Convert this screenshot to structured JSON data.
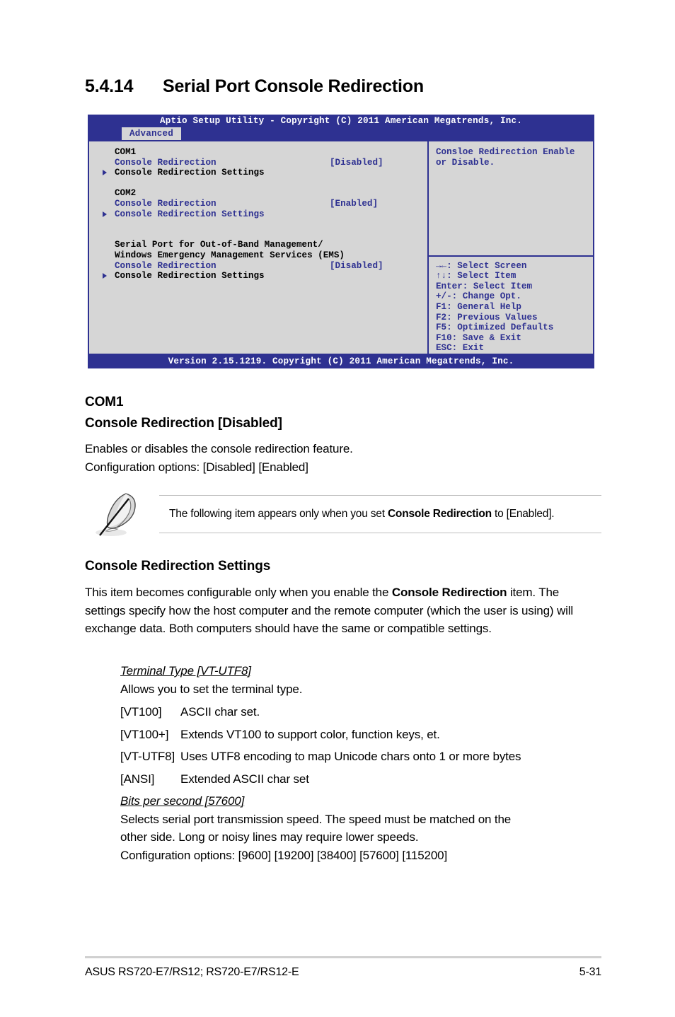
{
  "heading": {
    "number": "5.4.14",
    "title": "Serial Port Console Redirection"
  },
  "bios": {
    "titlebar": "Aptio Setup Utility - Copyright (C) 2011 American Megatrends, Inc.",
    "tab": "Advanced",
    "left_items": [
      {
        "label": "COM1",
        "value": "",
        "marker": false,
        "label_color": "black",
        "value_color": "black"
      },
      {
        "label": "Console Redirection",
        "value": "[Disabled]",
        "marker": false,
        "label_color": "blue",
        "value_color": "blue"
      },
      {
        "label": "Console Redirection Settings",
        "value": "",
        "marker": true,
        "label_color": "black",
        "value_color": "black"
      },
      {
        "label": "",
        "value": "",
        "marker": false,
        "label_color": "black",
        "value_color": "black"
      },
      {
        "label": "COM2",
        "value": "",
        "marker": false,
        "label_color": "black",
        "value_color": "black"
      },
      {
        "label": "Console Redirection",
        "value": "[Enabled]",
        "marker": false,
        "label_color": "blue",
        "value_color": "blue"
      },
      {
        "label": "Console Redirection Settings",
        "value": "",
        "marker": true,
        "label_color": "blue",
        "value_color": "blue"
      },
      {
        "label": "",
        "value": "",
        "marker": false,
        "label_color": "black",
        "value_color": "black"
      },
      {
        "label": "",
        "value": "",
        "marker": false,
        "label_color": "black",
        "value_color": "black"
      },
      {
        "label": "Serial Port for Out-of-Band Management/",
        "value": "",
        "marker": false,
        "label_color": "black",
        "value_color": "black"
      },
      {
        "label": "Windows Emergency Management Services (EMS)",
        "value": "",
        "marker": false,
        "label_color": "black",
        "value_color": "black"
      },
      {
        "label": "Console Redirection",
        "value": "[Disabled]",
        "marker": false,
        "label_color": "blue",
        "value_color": "blue"
      },
      {
        "label": "Console Redirection Settings",
        "value": "",
        "marker": true,
        "label_color": "black",
        "value_color": "black"
      }
    ],
    "help_lines": [
      "Consloe Redirection Enable",
      "or Disable."
    ],
    "key_legend": [
      "→←: Select Screen",
      "↑↓:  Select Item",
      "Enter: Select Item",
      "+/-: Change Opt.",
      "F1: General Help",
      "F2: Previous Values",
      "F5: Optimized Defaults",
      "F10: Save & Exit",
      "ESC: Exit"
    ],
    "footer": "Version 2.15.1219. Copyright (C) 2011 American Megatrends, Inc.",
    "colors": {
      "chrome_blue": "#2e3191",
      "panel_gray": "#d6d6d6",
      "text_white": "#ffffff"
    }
  },
  "com1_section": {
    "heading1": "COM1",
    "heading2": "Console Redirection [Disabled]",
    "line1": "Enables or disables the console redirection feature.",
    "line2": "Configuration options: [Disabled] [Enabled]"
  },
  "note": {
    "text_before": "The following item appears only when you set ",
    "bold": "Console Redirection",
    "text_after": " to [Enabled].",
    "icon": "quill-pen-icon"
  },
  "crs_section": {
    "heading": "Console Redirection Settings",
    "para_part1": "This item becomes configurable only when you enable the ",
    "para_bold": "Console Redirection",
    "para_part2": " item. The settings specify how the host computer and the remote computer (which the user is using) will exchange data. Both computers should have the same or compatible settings."
  },
  "terminal_type": {
    "title": "Terminal Type [VT-UTF8]",
    "desc": "Allows you to set the terminal type.",
    "options": [
      {
        "key": "[VT100]",
        "desc": "ASCII char set."
      },
      {
        "key": "[VT100+]",
        "desc": "Extends VT100 to support color, function keys, et."
      },
      {
        "key": "[VT-UTF8]",
        "desc": "Uses UTF8 encoding to map Unicode chars onto 1 or more bytes"
      },
      {
        "key": "[ANSI]",
        "desc": "Extended ASCII char set"
      }
    ]
  },
  "bits_per_second": {
    "title": "Bits per second [57600]",
    "desc_line1": "Selects serial port transmission speed. The speed must be matched on the",
    "desc_line2": "other side. Long or noisy lines may require lower speeds.",
    "config": "Configuration options: [9600] [19200] [38400] [57600] [115200]"
  },
  "page_footer": {
    "left": "ASUS RS720-E7/RS12; RS720-E7/RS12-E",
    "right": "5-31"
  }
}
